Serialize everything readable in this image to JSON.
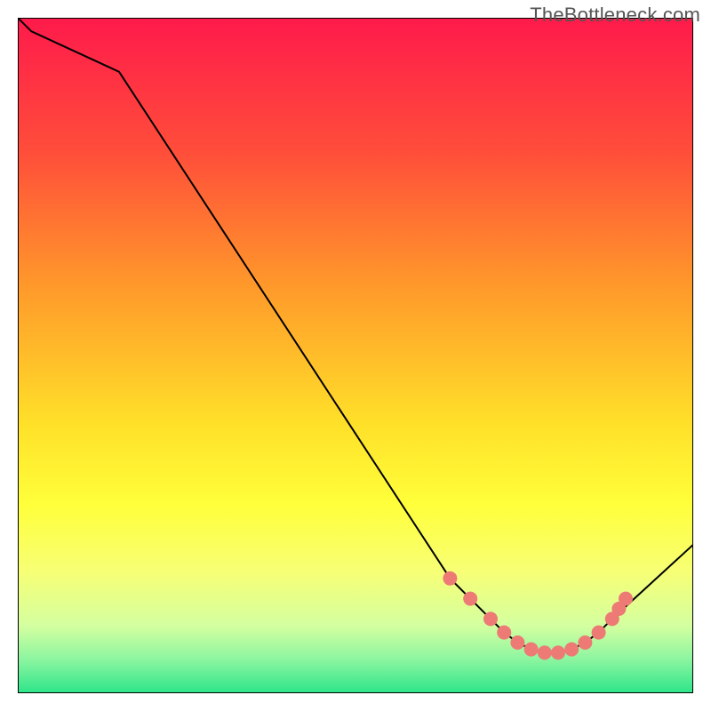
{
  "watermark": "TheBottleneck.com",
  "chart_data": {
    "type": "line",
    "title": "",
    "xlabel": "",
    "ylabel": "",
    "xlim": [
      0,
      100
    ],
    "ylim": [
      0,
      100
    ],
    "grid": false,
    "series": [
      {
        "name": "bottleneck-curve",
        "x": [
          0,
          2,
          15,
          64,
          70,
          72,
          74,
          76,
          78,
          80,
          82,
          84,
          86,
          88,
          100
        ],
        "values": [
          100,
          98,
          92,
          17,
          11,
          9,
          7.5,
          6.5,
          6,
          6,
          6.5,
          7.5,
          9,
          11,
          22
        ]
      }
    ],
    "markers": {
      "name": "data-points",
      "color": "#ed7a75",
      "radius_px": 8,
      "x": [
        64,
        67,
        70,
        72,
        74,
        76,
        78,
        80,
        82,
        84,
        86,
        88,
        89,
        90
      ],
      "values": [
        17,
        14,
        11,
        9,
        7.5,
        6.5,
        6,
        6,
        6.5,
        7.5,
        9,
        11,
        12.5,
        14
      ]
    },
    "background_gradient": {
      "type": "vertical",
      "stops": [
        {
          "offset": 0.0,
          "color": "#ff1a4b"
        },
        {
          "offset": 0.2,
          "color": "#ff4e3a"
        },
        {
          "offset": 0.4,
          "color": "#ff9a2a"
        },
        {
          "offset": 0.6,
          "color": "#ffe029"
        },
        {
          "offset": 0.72,
          "color": "#ffff3a"
        },
        {
          "offset": 0.82,
          "color": "#f7ff75"
        },
        {
          "offset": 0.9,
          "color": "#d4ffa0"
        },
        {
          "offset": 0.95,
          "color": "#8cf5a0"
        },
        {
          "offset": 1.0,
          "color": "#2de58a"
        }
      ]
    }
  }
}
